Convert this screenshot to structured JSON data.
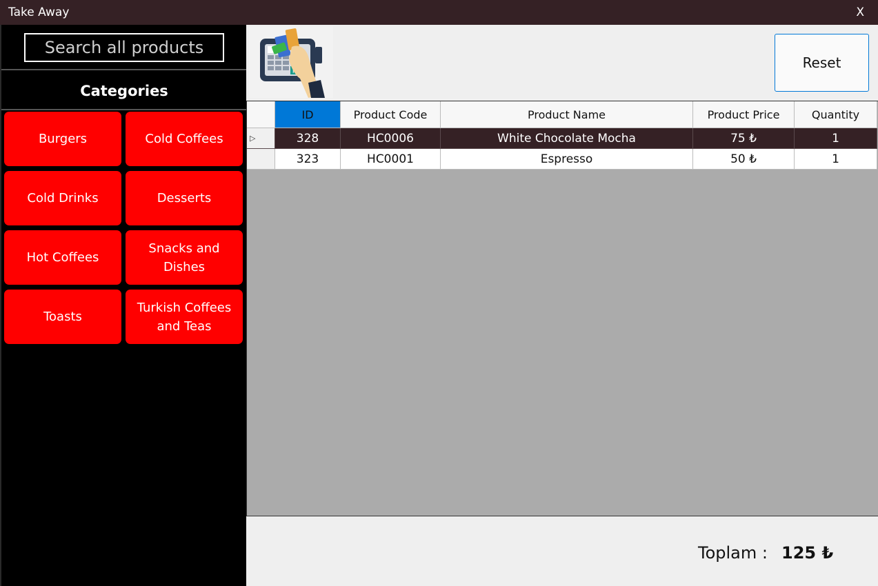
{
  "window": {
    "title": "Take Away",
    "close_label": "X"
  },
  "search": {
    "placeholder": "Search all products"
  },
  "sidebar": {
    "categories_title": "Categories",
    "categories": [
      {
        "label": "Burgers"
      },
      {
        "label": "Cold Coffees"
      },
      {
        "label": "Cold Drinks"
      },
      {
        "label": "Desserts"
      },
      {
        "label": "Hot Coffees"
      },
      {
        "label": "Snacks and Dishes"
      },
      {
        "label": "Toasts"
      },
      {
        "label": "Turkish Coffees and Teas"
      }
    ]
  },
  "toolbar": {
    "reset_label": "Reset",
    "logo_icon": "payment-terminal-icon"
  },
  "table": {
    "columns": [
      "ID",
      "Product Code",
      "Product Name",
      "Product Price",
      "Quantity"
    ],
    "rows": [
      {
        "id": "328",
        "code": "HC0006",
        "name": "White Chocolate Mocha",
        "price": "75 ₺",
        "quantity": "1",
        "selected": true
      },
      {
        "id": "323",
        "code": "HC0001",
        "name": "Espresso",
        "price": "50 ₺",
        "quantity": "1",
        "selected": false
      }
    ]
  },
  "footer": {
    "total_label": "Toplam :",
    "total_value": "125 ₺"
  },
  "colors": {
    "titlebar": "#352125",
    "category_button": "#ff0000",
    "selected_header": "#0078d7",
    "selected_row": "#352125"
  }
}
